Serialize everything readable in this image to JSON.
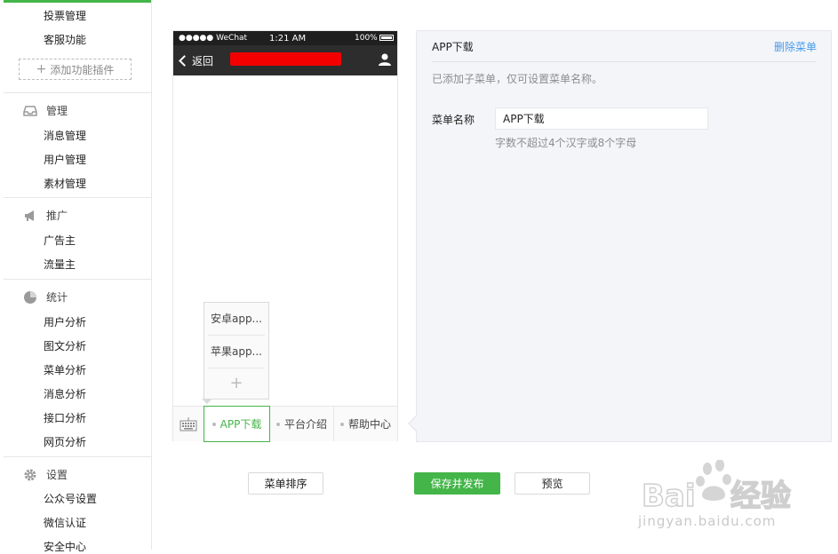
{
  "sidebar": {
    "items_top": [
      "投票管理",
      "客服功能"
    ],
    "add_plugin_label": "添加功能插件",
    "sections": [
      {
        "title": "管理",
        "icon": "inbox-icon",
        "items": [
          "消息管理",
          "用户管理",
          "素材管理"
        ]
      },
      {
        "title": "推广",
        "icon": "megaphone-icon",
        "items": [
          "广告主",
          "流量主"
        ]
      },
      {
        "title": "统计",
        "icon": "pie-chart-icon",
        "items": [
          "用户分析",
          "图文分析",
          "菜单分析",
          "消息分析",
          "接口分析",
          "网页分析"
        ]
      },
      {
        "title": "设置",
        "icon": "gear-icon",
        "items": [
          "公众号设置",
          "微信认证",
          "安全中心"
        ]
      }
    ]
  },
  "phone": {
    "status": {
      "carrier": "●●●●● WeChat",
      "time": "1:21 AM",
      "battery": "100%"
    },
    "back_label": "返回",
    "submenu_items": [
      "安卓app...",
      "苹果app..."
    ],
    "menu_tabs": [
      "APP下载",
      "平台介绍",
      "帮助中心"
    ],
    "active_tab_index": 0
  },
  "panel": {
    "title": "APP下载",
    "delete_label": "删除菜单",
    "hint": "已添加子菜单，仅可设置菜单名称。",
    "field_label": "菜单名称",
    "field_value": "APP下载",
    "field_tip": "字数不超过4个汉字或8个字母"
  },
  "buttons": {
    "sort_label": "菜单排序",
    "save_publish_label": "保存并发布",
    "preview_label": "预览"
  },
  "watermark": {
    "brand": "Baidu经验",
    "url": "jingyan.baidu.com"
  },
  "colors": {
    "accent_green": "#44b549",
    "link_blue": "#459ae9",
    "redaction": "#f40000"
  }
}
